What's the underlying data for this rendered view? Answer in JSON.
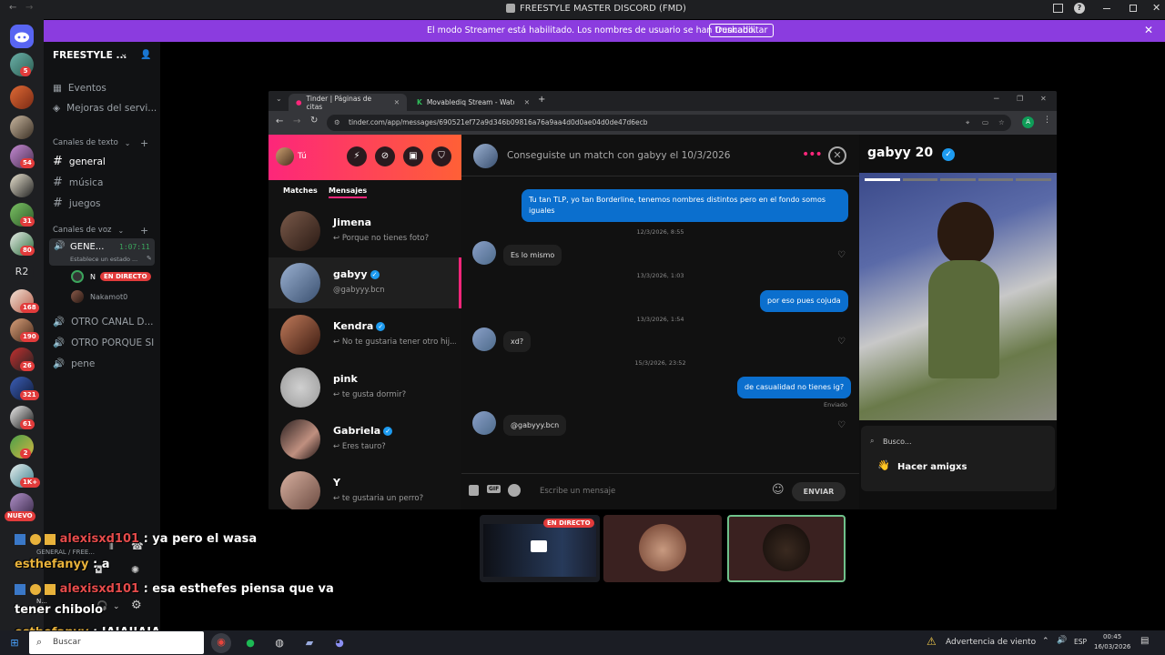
{
  "titlebar": {
    "title": "FREESTYLE MASTER DISCORD (FMD)",
    "back": "←",
    "forward": "→"
  },
  "banner": {
    "text": "El modo Streamer está habilitado. Los nombres de usuario se han truncado.",
    "button": "Deshabilitar"
  },
  "servers": {
    "badges": [
      "5",
      "54",
      "31",
      "80",
      "R2",
      "168",
      "190",
      "26",
      "321",
      "61",
      "2",
      "1K+",
      "NUEVO"
    ]
  },
  "channels": {
    "server_name": "FREESTYLE ...",
    "events": "Eventos",
    "boosts": "Mejoras del servi...",
    "text_category": "Canales de texto",
    "text_channels": [
      "general",
      "música",
      "juegos"
    ],
    "voice_category": "Canales de voz",
    "voice_active": {
      "name": "GENE...",
      "timer": "1:07:11",
      "status": "Establece un estado ..."
    },
    "voice_users": [
      {
        "name": "N",
        "live": "EN DIRECTO"
      },
      {
        "name": "Nakamot0"
      }
    ],
    "voice_channels": [
      "OTRO CANAL D...",
      "OTRO PORQUE SI",
      "pene"
    ],
    "user_panel": {
      "voice_line": "GENERAL / FREE...",
      "name": "N..."
    }
  },
  "browser": {
    "tabs": [
      {
        "label": "Tinder | Páginas de citas"
      },
      {
        "label": "Movablediq Stream - Watch Li..."
      }
    ],
    "url": "tinder.com/app/messages/690521ef72a9d346b09816a76a9aa4d0d0ae04d0de47d6ecb",
    "profile_initial": "A"
  },
  "tinder": {
    "user_label": "Tú",
    "tabs": {
      "matches": "Matches",
      "messages": "Mensajes"
    },
    "matches": [
      {
        "name": "Jimena",
        "preview": "↩ Porque no tienes foto?",
        "verified": false
      },
      {
        "name": "gabyy",
        "preview": "@gabyyy.bcn",
        "verified": true
      },
      {
        "name": "Kendra",
        "preview": "↩ No te gustaria tener otro hij...",
        "verified": true
      },
      {
        "name": "pink",
        "preview": "↩ te gusta dormir?",
        "verified": false
      },
      {
        "name": "Gabriela",
        "preview": "↩ Eres tauro?",
        "verified": true
      },
      {
        "name": "Y",
        "preview": "↩ te gustaria un perro?",
        "verified": false
      }
    ],
    "chat_header": "Conseguiste un match con gabyy el 10/3/2026",
    "messages": [
      {
        "dir": "out",
        "text": "Tu tan TLP, yo tan Borderline, tenemos nombres distintos pero en el fondo somos iguales"
      },
      {
        "ts": "12/3/2026, 8:55"
      },
      {
        "dir": "in",
        "text": "Es lo mismo"
      },
      {
        "ts": "13/3/2026, 1:03"
      },
      {
        "dir": "out",
        "text": "por eso pues cojuda"
      },
      {
        "ts": "13/3/2026, 1:54"
      },
      {
        "dir": "in",
        "text": "xd?"
      },
      {
        "ts": "15/3/2026, 23:52"
      },
      {
        "dir": "out",
        "text": "de casualidad no tienes ig?"
      },
      {
        "status": "Enviado"
      },
      {
        "dir": "in",
        "text": "@gabyyy.bcn"
      }
    ],
    "input_placeholder": "Escribe un mensaje",
    "gif_label": "GIF",
    "send": "ENVIAR",
    "profile": {
      "name_age": "gabyy 20",
      "search": "Busco...",
      "looking": "Hacer amigxs",
      "wave": "👋"
    }
  },
  "call": {
    "live": "EN DIRECTO"
  },
  "chat_overlay": [
    {
      "nick": "alexisxd101",
      "msg": " : ya pero el wasa",
      "color": "#e54b4b"
    },
    {
      "nick": "esthefanyy",
      "msg": " : a",
      "color": "#e8b23b"
    },
    {
      "nick": "alexisxd101",
      "msg": " : esa esthefes piensa que va",
      "color": "#e54b4b"
    },
    {
      "nick": "",
      "msg": "tener chibolo",
      "color": "#ffffff"
    },
    {
      "nick": "esthefanyy",
      "msg": " : JAJAJJAJA",
      "color": "#e8b23b"
    }
  ],
  "taskbar": {
    "search": "Buscar",
    "weather": "Advertencia de viento",
    "lang": "ESP",
    "time": "00:45",
    "date": "16/03/2026"
  },
  "colors": {
    "discord_purple": "#8b3cdf",
    "tinder_pink": "#fd267a",
    "message_blue": "#0b6fce",
    "live_red": "#e23b3b"
  }
}
